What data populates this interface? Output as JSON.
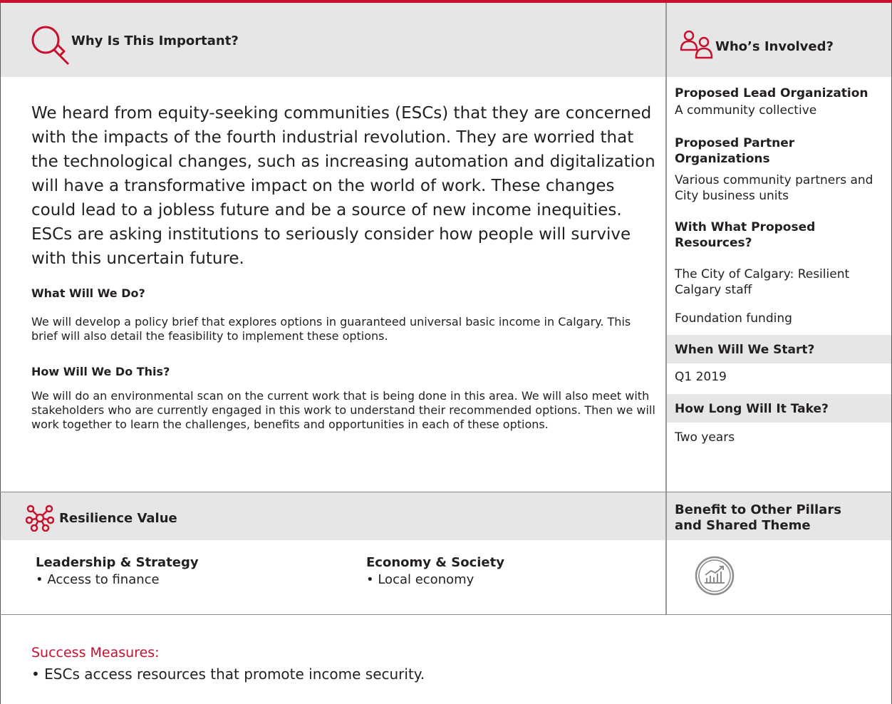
{
  "accent_color": "#c8102e",
  "why": {
    "title": "Why Is This Important?",
    "icon": "magnifier-icon",
    "lead": "We heard from equity-seeking communities (ESCs) that they are concerned with the impacts of the fourth industrial revolution. They are worried that the technological changes, such as increasing automation and digitalization will have a transformative impact on the world of work. These changes could lead to a jobless future and be a source of new income inequities. ESCs are asking institutions to seriously consider how people will survive with this uncertain future.",
    "what_heading": "What Will We Do?",
    "what_text": "We will develop a policy brief that explores options in guaranteed universal basic income in Calgary. This brief will also detail the feasibility to implement these options.",
    "how_heading": "How Will We Do This?",
    "how_text": "We will do an environmental scan on the current work that is being done in this area. We will also meet with stakeholders who are currently engaged in this work to understand their recommended options. Then we will work together to learn the challenges, benefits and opportunities in each of these options."
  },
  "who": {
    "title": "Who’s Involved?",
    "icon": "people-icon",
    "lead_org_label": "Proposed Lead Organization",
    "lead_org_value": "A community collective",
    "partner_label": "Proposed Partner Organizations",
    "partner_value": "Various community partners and City business units",
    "resources_label": "With What Proposed Resources?",
    "resources_value_1": "The City of Calgary: Resilient Calgary staff",
    "resources_value_2": "Foundation funding",
    "start_label": "When Will We Start?",
    "start_value": "Q1 2019",
    "duration_label": "How Long Will It Take?",
    "duration_value": "Two years"
  },
  "resilience": {
    "title": "Resilience Value",
    "icon": "network-icon",
    "columns": [
      {
        "heading": "Leadership & Strategy",
        "item": "• Access to finance"
      },
      {
        "heading": "Economy & Society",
        "item": "• Local economy"
      }
    ]
  },
  "benefit": {
    "title": "Benefit to Other Pillars and Shared Theme",
    "icon": "economy-chart-icon"
  },
  "success": {
    "title": "Success Measures:",
    "items": [
      "• ESCs access resources that promote income security."
    ]
  }
}
